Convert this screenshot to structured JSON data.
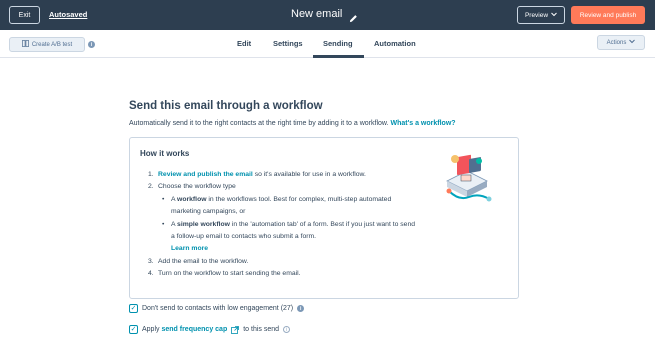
{
  "topbar": {
    "exit_label": "Exit",
    "autosaved_label": "Autosaved",
    "title": "New email",
    "preview_label": "Preview",
    "publish_label": "Review and publish"
  },
  "navbar": {
    "ab_label": "Create A/B test",
    "tabs": [
      {
        "label": "Edit"
      },
      {
        "label": "Settings"
      },
      {
        "label": "Sending",
        "active": true
      },
      {
        "label": "Automation"
      }
    ],
    "actions_label": "Actions"
  },
  "main": {
    "heading": "Send this email through a workflow",
    "subtext": "Automatically send it to the right contacts at the right time by adding it to a workflow.",
    "subtext_link": "What's a workflow?",
    "card": {
      "title": "How it works",
      "step1_link": "Review and publish the email",
      "step1_rest": " so it's available for use in a workflow.",
      "step2": "Choose the workflow type",
      "sub1_pre": "A ",
      "sub1_bold": "workflow",
      "sub1_rest": " in the workflows tool. Best for complex, multi-step automated marketing campaigns, or",
      "sub2_pre": "A ",
      "sub2_bold": "simple workflow",
      "sub2_rest": " in the 'automation tab' of a form. Best if you just want to send a follow-up email to contacts who submit a form.",
      "learn_more": "Learn more",
      "step3": "Add the email to the workflow.",
      "step4": "Turn on the workflow to start sending the email."
    },
    "check1_label": "Don't send to contacts with low engagement (27)",
    "check2_pre": "Apply ",
    "check2_link": "send frequency cap",
    "check2_post": " to this send"
  },
  "colors": {
    "topbar": "#2d3e50",
    "accent": "#ff7a59",
    "link": "#0091ae"
  }
}
